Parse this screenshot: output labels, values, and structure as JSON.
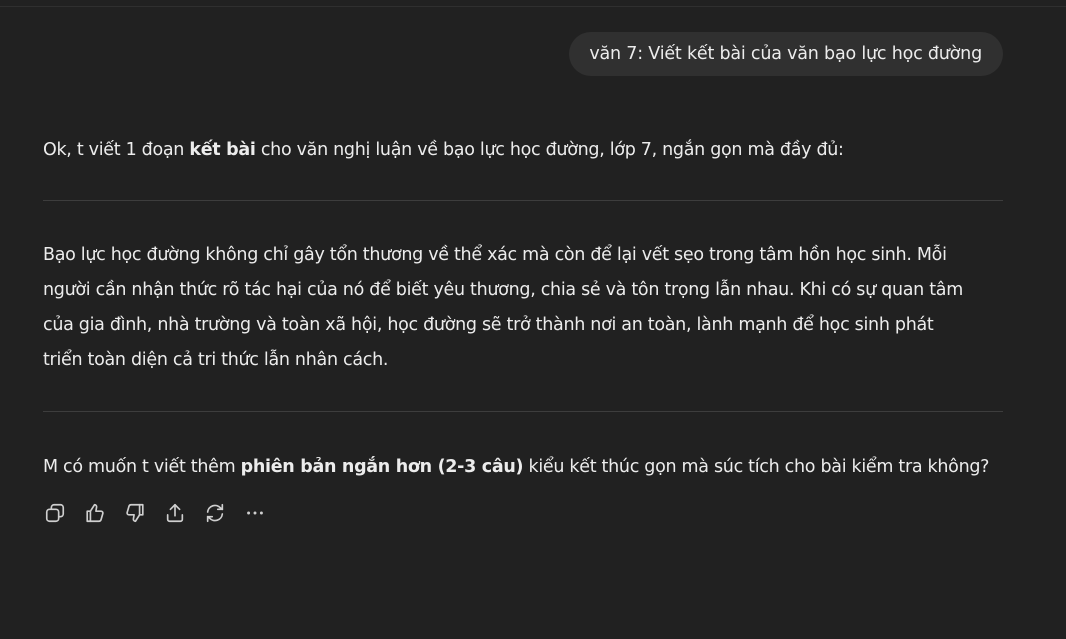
{
  "user_message": "văn 7: Viết kết bài của văn bạo lực học đường",
  "assistant": {
    "intro": {
      "before": "Ok, t viết 1 đoạn ",
      "bold": "kết bài",
      "after": " cho văn nghị luận về bạo lực học đường, lớp 7, ngắn gọn mà đầy đủ:"
    },
    "paragraph_lines": [
      "Bạo lực học đường không chỉ gây tổn thương về thể xác mà còn để lại vết sẹo trong tâm hồn học sinh. Mỗi",
      "người cần nhận thức rõ tác hại của nó để biết yêu thương, chia sẻ và tôn trọng lẫn nhau. Khi có sự quan tâm",
      "của gia đình, nhà trường và toàn xã hội, học đường sẽ trở thành nơi an toàn, lành mạnh để học sinh phát",
      "triển toàn diện cả tri thức lẫn nhân cách."
    ],
    "closing": {
      "before": "M có muốn t viết thêm ",
      "bold": "phiên bản ngắn hơn (2-3 câu)",
      "after": " kiểu kết thúc gọn mà súc tích cho bài kiểm tra không?"
    }
  },
  "actions": [
    {
      "icon": "copy-icon"
    },
    {
      "icon": "thumbs-up-icon"
    },
    {
      "icon": "thumbs-down-icon"
    },
    {
      "icon": "share-icon"
    },
    {
      "icon": "regenerate-icon"
    },
    {
      "icon": "more-icon"
    }
  ],
  "colors": {
    "background": "#212121",
    "bubble": "#303030",
    "text": "#ececec",
    "divider": "#3d3d3d"
  }
}
